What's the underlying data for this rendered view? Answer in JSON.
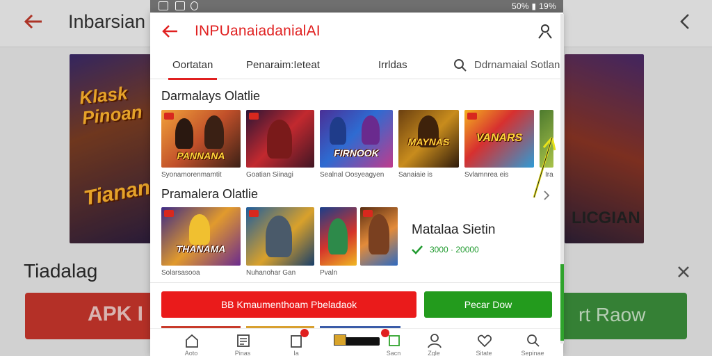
{
  "background": {
    "title": "Inbarsian",
    "art_left_line1": "Klask",
    "art_left_line2": "Pinoan",
    "art_left_line3": "Tiananan",
    "art_right_text": "LICGIAN",
    "section_title": "Tiadalag",
    "apk_button": "APK I",
    "raow_button": "rt Raow"
  },
  "status_bar": {
    "right_text": "50% ▮ 19%"
  },
  "header": {
    "title": "INPUanaiadanialAI"
  },
  "tabs": [
    {
      "label": "Oortatan"
    },
    {
      "label": "Penaraim:Ieteat"
    },
    {
      "label": "Irrldas"
    },
    {
      "label": "Ddrnamaial Sotlan"
    }
  ],
  "section1": {
    "title": "Darmalays Olatlie",
    "tiles": [
      {
        "art": "PANNANA",
        "caption": "Syonamorenmamtit"
      },
      {
        "art": "",
        "caption": "Goatian Siinagi"
      },
      {
        "art": "FIRNOOK",
        "caption": "Sealnal Oosyeagyen"
      },
      {
        "art": "MAYNAS",
        "caption": "Sanaiaie is"
      },
      {
        "art": "VANARS",
        "caption": "Svlamnrea eis"
      },
      {
        "art": "",
        "caption": "Ira"
      }
    ]
  },
  "section2": {
    "title": "Pramalera Olatlie",
    "tiles": [
      {
        "art": "THANAMA",
        "caption": "Solarsasooa"
      },
      {
        "art": "",
        "caption": "Nuhanohar Gan"
      },
      {
        "art": "",
        "caption": "Pvaln"
      },
      {
        "art": "",
        "caption": ""
      }
    ],
    "feature_title": "Matalaa Sietin",
    "feature_subtitle": "3000 · 20000"
  },
  "buttons": {
    "download": "BB Kmaumenthoam Pbeladaok",
    "green": "Pecar Dow"
  },
  "navbar": [
    {
      "label": "Aoto",
      "icon": "home-icon"
    },
    {
      "label": "Pinas",
      "icon": "news-icon"
    },
    {
      "label": "Ia",
      "icon": "notification-icon"
    },
    {
      "label": "",
      "icon": "media-icon"
    },
    {
      "label": "Sacn",
      "icon": "gallery-icon"
    },
    {
      "label": "Zgle",
      "icon": "profile-icon"
    },
    {
      "label": "Sitate",
      "icon": "heart-icon"
    },
    {
      "label": "Sepinae",
      "icon": "search-icon"
    }
  ],
  "colors": {
    "accent_red": "#e02020",
    "accent_green": "#239b1d"
  }
}
